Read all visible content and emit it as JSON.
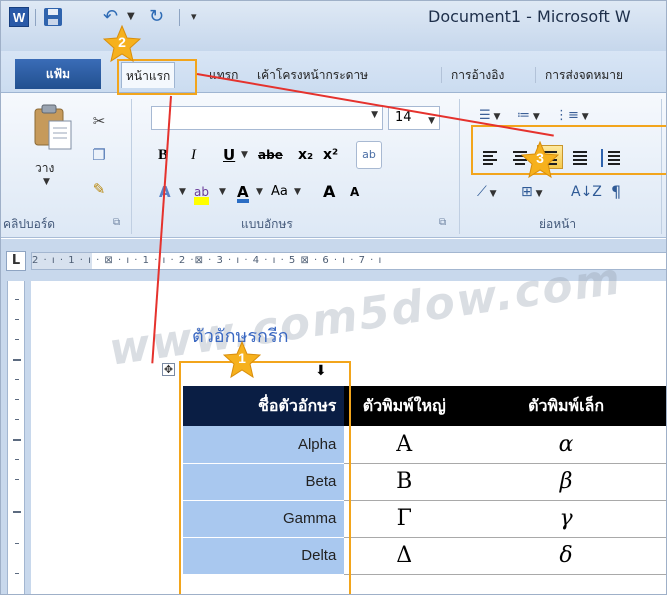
{
  "window": {
    "title": "Document1 - Microsoft W",
    "word_logo": "W"
  },
  "tabs": [
    {
      "label": "แฟ้ม"
    },
    {
      "label": "หน้าแรก"
    },
    {
      "label": "แทรก"
    },
    {
      "label": "เค้าโครงหน้ากระดาษ"
    },
    {
      "label": "การอ้างอิง"
    },
    {
      "label": "การส่งจดหมาย"
    }
  ],
  "ribbon": {
    "clipboard": {
      "paste_label": "วาง",
      "group_label": "คลิปบอร์ด"
    },
    "font": {
      "font_name": "",
      "font_size": "14",
      "group_label": "แบบอักษร",
      "bold": "B",
      "italic": "I",
      "underline": "U",
      "strike": "abe",
      "subscript": "x₂",
      "superscript": "x²",
      "grow": "A",
      "shrink": "A",
      "change_case": "Aa"
    },
    "paragraph": {
      "group_label": "ย่อหน้า",
      "active_alignment": "align-right"
    }
  },
  "ruler": {
    "text": "2 · ı · 1 · ı · ⊠ · ı · 1 · ı · 2 ·⊠ · 3 · ı · 4 · ı · 5 ⊠ · 6 · ı · 7 · ı"
  },
  "document": {
    "watermark": "www.com5dow.com",
    "heading": "ตัวอักษรกรีก",
    "table": {
      "headers": [
        "ชื่อตัวอักษร",
        "ตัวพิมพ์ใหญ่",
        "ตัวพิมพ์เล็ก"
      ],
      "rows": [
        [
          "Alpha",
          "A",
          "α"
        ],
        [
          "Beta",
          "B",
          "β"
        ],
        [
          "Gamma",
          "Γ",
          "γ"
        ],
        [
          "Delta",
          "Δ",
          "δ"
        ]
      ]
    }
  },
  "annotations": {
    "steps": [
      "1",
      "2",
      "3"
    ],
    "highlight_color": "#f2a51c",
    "line_color": "#e5322d"
  }
}
